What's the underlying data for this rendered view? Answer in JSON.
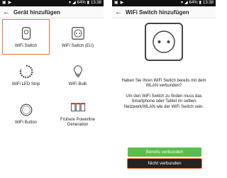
{
  "statusbar": {
    "time": "13:38",
    "battery": "64%"
  },
  "left": {
    "title": "Gerät hinzufügen",
    "tiles": [
      {
        "label": "WiFi Switch",
        "icon": "smart-plug-icon",
        "selected": true
      },
      {
        "label": "WiFi Switch (EU)",
        "icon": "eu-socket-icon",
        "selected": false
      },
      {
        "label": "WiFi LED Strip",
        "icon": "led-strip-icon",
        "selected": false
      },
      {
        "label": "WiFi Bulb",
        "icon": "bulb-icon",
        "selected": false
      },
      {
        "label": "WiFi Button",
        "icon": "round-button-icon",
        "selected": false
      },
      {
        "label": "Frühere Powerline Generation",
        "icon": "powerline-adapters-icon",
        "selected": false
      }
    ]
  },
  "right": {
    "title": "WiFi Switch hinzufügen",
    "question": "Haben Sie Ihren WiFi Switch bereits mit dem WLAN verbunden?",
    "description": "Um den WiFi Switch zu finden muss das Smartphone oder Tablet im selben Netzwerk/WLAN wie der WiFi Switch sein.",
    "btn_connected": "Bereits verbunden",
    "btn_not_connected": "Nicht verbunden"
  },
  "colors": {
    "accent": "#e8713c",
    "green": "#5bbd4d",
    "dark": "#222222"
  }
}
